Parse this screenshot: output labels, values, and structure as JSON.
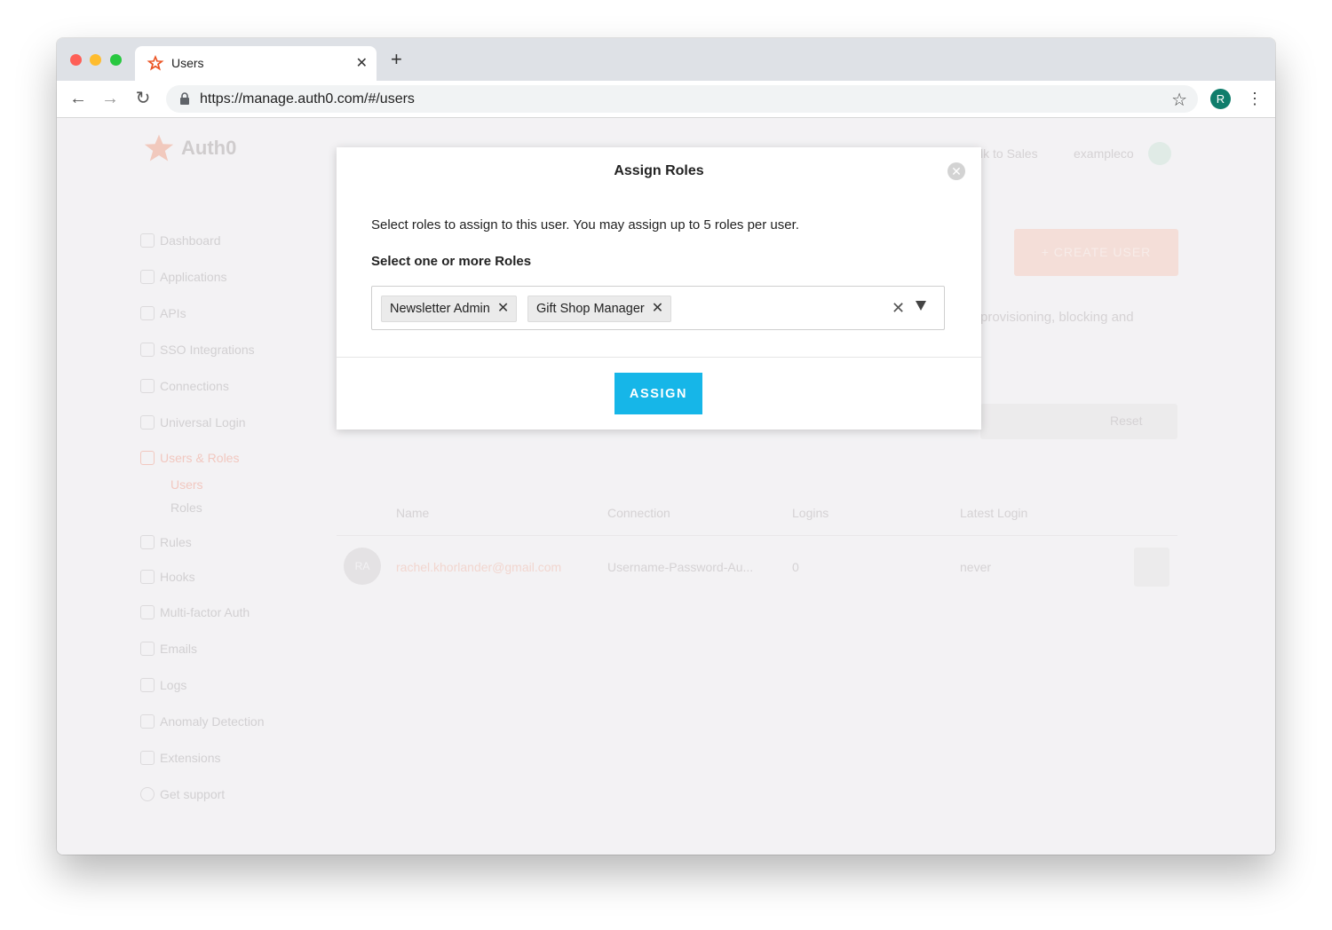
{
  "browser": {
    "tab_title": "Users",
    "url": "https://manage.auth0.com/#/users",
    "profile_initial": "R"
  },
  "background": {
    "brand": "Auth0",
    "header_links": [
      "lk to Sales",
      "exampleco"
    ],
    "sidebar": [
      {
        "label": "Dashboard"
      },
      {
        "label": "Applications"
      },
      {
        "label": "APIs"
      },
      {
        "label": "SSO Integrations"
      },
      {
        "label": "Connections"
      },
      {
        "label": "Universal Login"
      },
      {
        "label": "Users & Roles",
        "active": true
      },
      {
        "label": "Rules"
      },
      {
        "label": "Hooks"
      },
      {
        "label": "Multi-factor Auth"
      },
      {
        "label": "Emails"
      },
      {
        "label": "Logs"
      },
      {
        "label": "Anomaly Detection"
      },
      {
        "label": "Extensions"
      },
      {
        "label": "Get support"
      }
    ],
    "sidebar_sub": [
      "Users",
      "Roles"
    ],
    "create_user_label": "+ CREATE USER",
    "page_description_fragment": "provisioning, blocking and",
    "reset_label": "Reset",
    "table_headers": [
      "Name",
      "Connection",
      "Logins",
      "Latest Login"
    ],
    "table_row": {
      "initials": "RA",
      "email": "rachel.khorlander@gmail.com",
      "connection": "Username-Password-Au...",
      "logins": "0",
      "latest_login": "never"
    }
  },
  "modal": {
    "title": "Assign Roles",
    "description": "Select roles to assign to this user. You may assign up to 5 roles per user.",
    "field_label": "Select one or more Roles",
    "selected_roles": [
      "Newsletter Admin",
      "Gift Shop Manager"
    ],
    "assign_label": "ASSIGN"
  },
  "colors": {
    "accent": "#16b6e8",
    "brand_red": "#eb5424",
    "profile_green": "#0f7d6b"
  }
}
